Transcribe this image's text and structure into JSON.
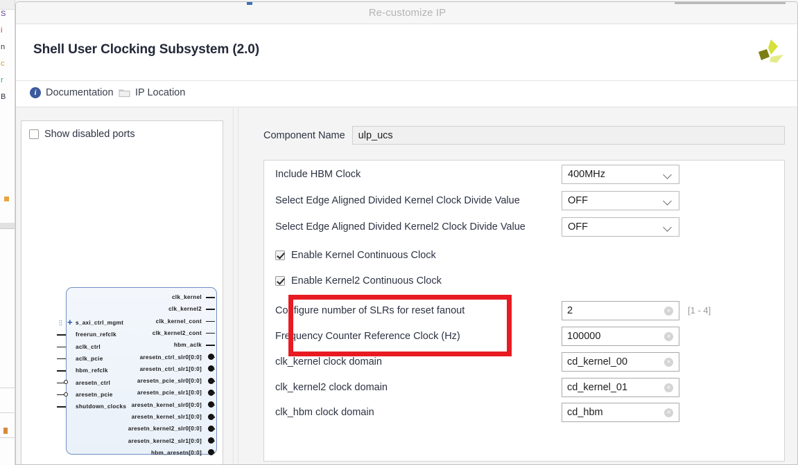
{
  "window": {
    "titlebar_text": "Re-customize IP",
    "ip_title": "Shell User Clocking Subsystem (2.0)",
    "logo_name": "amd-xilinx-logo"
  },
  "toolbar": {
    "documentation_label": "Documentation",
    "documentation_icon": "info-icon",
    "ip_location_label": "IP Location",
    "ip_location_icon": "folder-icon"
  },
  "left_panel": {
    "show_disabled_ports_label": "Show disabled ports",
    "show_disabled_ports_checked": false,
    "symbol": {
      "left_pins": [
        {
          "label": "s_axi_ctrl_mgmt",
          "type": "bus"
        },
        {
          "label": "freerun_refclk",
          "type": "stub"
        },
        {
          "label": "aclk_ctrl",
          "type": "stub"
        },
        {
          "label": "aclk_pcie",
          "type": "stub"
        },
        {
          "label": "hbm_refclk",
          "type": "stub"
        },
        {
          "label": "aresetn_ctrl",
          "type": "bubble"
        },
        {
          "label": "aresetn_pcie",
          "type": "bubble"
        },
        {
          "label": "shutdown_clocks",
          "type": "stub"
        }
      ],
      "right_pins": [
        {
          "label": "clk_kernel",
          "type": "stub"
        },
        {
          "label": "clk_kernel2",
          "type": "stub"
        },
        {
          "label": "clk_kernel_cont",
          "type": "stub"
        },
        {
          "label": "clk_kernel2_cont",
          "type": "stub"
        },
        {
          "label": "hbm_aclk",
          "type": "stub"
        },
        {
          "label": "aresetn_ctrl_slr0[0:0]",
          "type": "dot"
        },
        {
          "label": "aresetn_ctrl_slr1[0:0]",
          "type": "dot"
        },
        {
          "label": "aresetn_pcie_slr0[0:0]",
          "type": "dot"
        },
        {
          "label": "aresetn_pcie_slr1[0:0]",
          "type": "dot"
        },
        {
          "label": "aresetn_kernel_slr0[0:0]",
          "type": "dot"
        },
        {
          "label": "aresetn_kernel_slr1[0:0]",
          "type": "dot"
        },
        {
          "label": "aresetn_kernel2_slr0[0:0]",
          "type": "dot"
        },
        {
          "label": "aresetn_kernel2_slr1[0:0]",
          "type": "dot"
        },
        {
          "label": "hbm_aresetn[0:0]",
          "type": "dot"
        }
      ]
    }
  },
  "right_panel": {
    "component_name_label": "Component Name",
    "component_name_value": "ulp_ucs",
    "fields": [
      {
        "kind": "select",
        "label": "Include HBM Clock",
        "value": "400MHz",
        "name": "include-hbm-clock"
      },
      {
        "kind": "select",
        "label": "Select Edge Aligned Divided Kernel Clock Divide Value",
        "value": "OFF",
        "name": "kernel-clock-divide-value"
      },
      {
        "kind": "select",
        "label": "Select Edge Aligned Divided Kernel2 Clock Divide Value",
        "value": "OFF",
        "name": "kernel2-clock-divide-value"
      },
      {
        "kind": "checkbox",
        "label": "Enable Kernel Continuous Clock",
        "checked": true,
        "name": "enable-kernel-continuous-clock"
      },
      {
        "kind": "checkbox",
        "label": "Enable Kernel2 Continuous Clock",
        "checked": true,
        "name": "enable-kernel2-continuous-clock"
      },
      {
        "kind": "text",
        "label": "Configure number of SLRs for reset fanout",
        "value": "2",
        "hint": "[1 - 4]",
        "name": "slr-reset-fanout"
      },
      {
        "kind": "text",
        "label": "Frequency Counter Reference Clock (Hz)",
        "value": "100000",
        "hint": "",
        "name": "freq-counter-ref-clock"
      },
      {
        "kind": "text",
        "label": "clk_kernel clock domain",
        "value": "cd_kernel_00",
        "hint": "",
        "name": "clk-kernel-clock-domain"
      },
      {
        "kind": "text",
        "label": "clk_kernel2 clock domain",
        "value": "cd_kernel_01",
        "hint": "",
        "name": "clk-kernel2-clock-domain"
      },
      {
        "kind": "text",
        "label": "clk_hbm clock domain",
        "value": "cd_hbm",
        "hint": "",
        "name": "clk-hbm-clock-domain"
      }
    ]
  },
  "annotation": {
    "highlight_color": "#e81b23"
  },
  "background_window": {
    "edge_chars": [
      "S",
      "i",
      "n",
      "c",
      "r",
      "B"
    ]
  }
}
